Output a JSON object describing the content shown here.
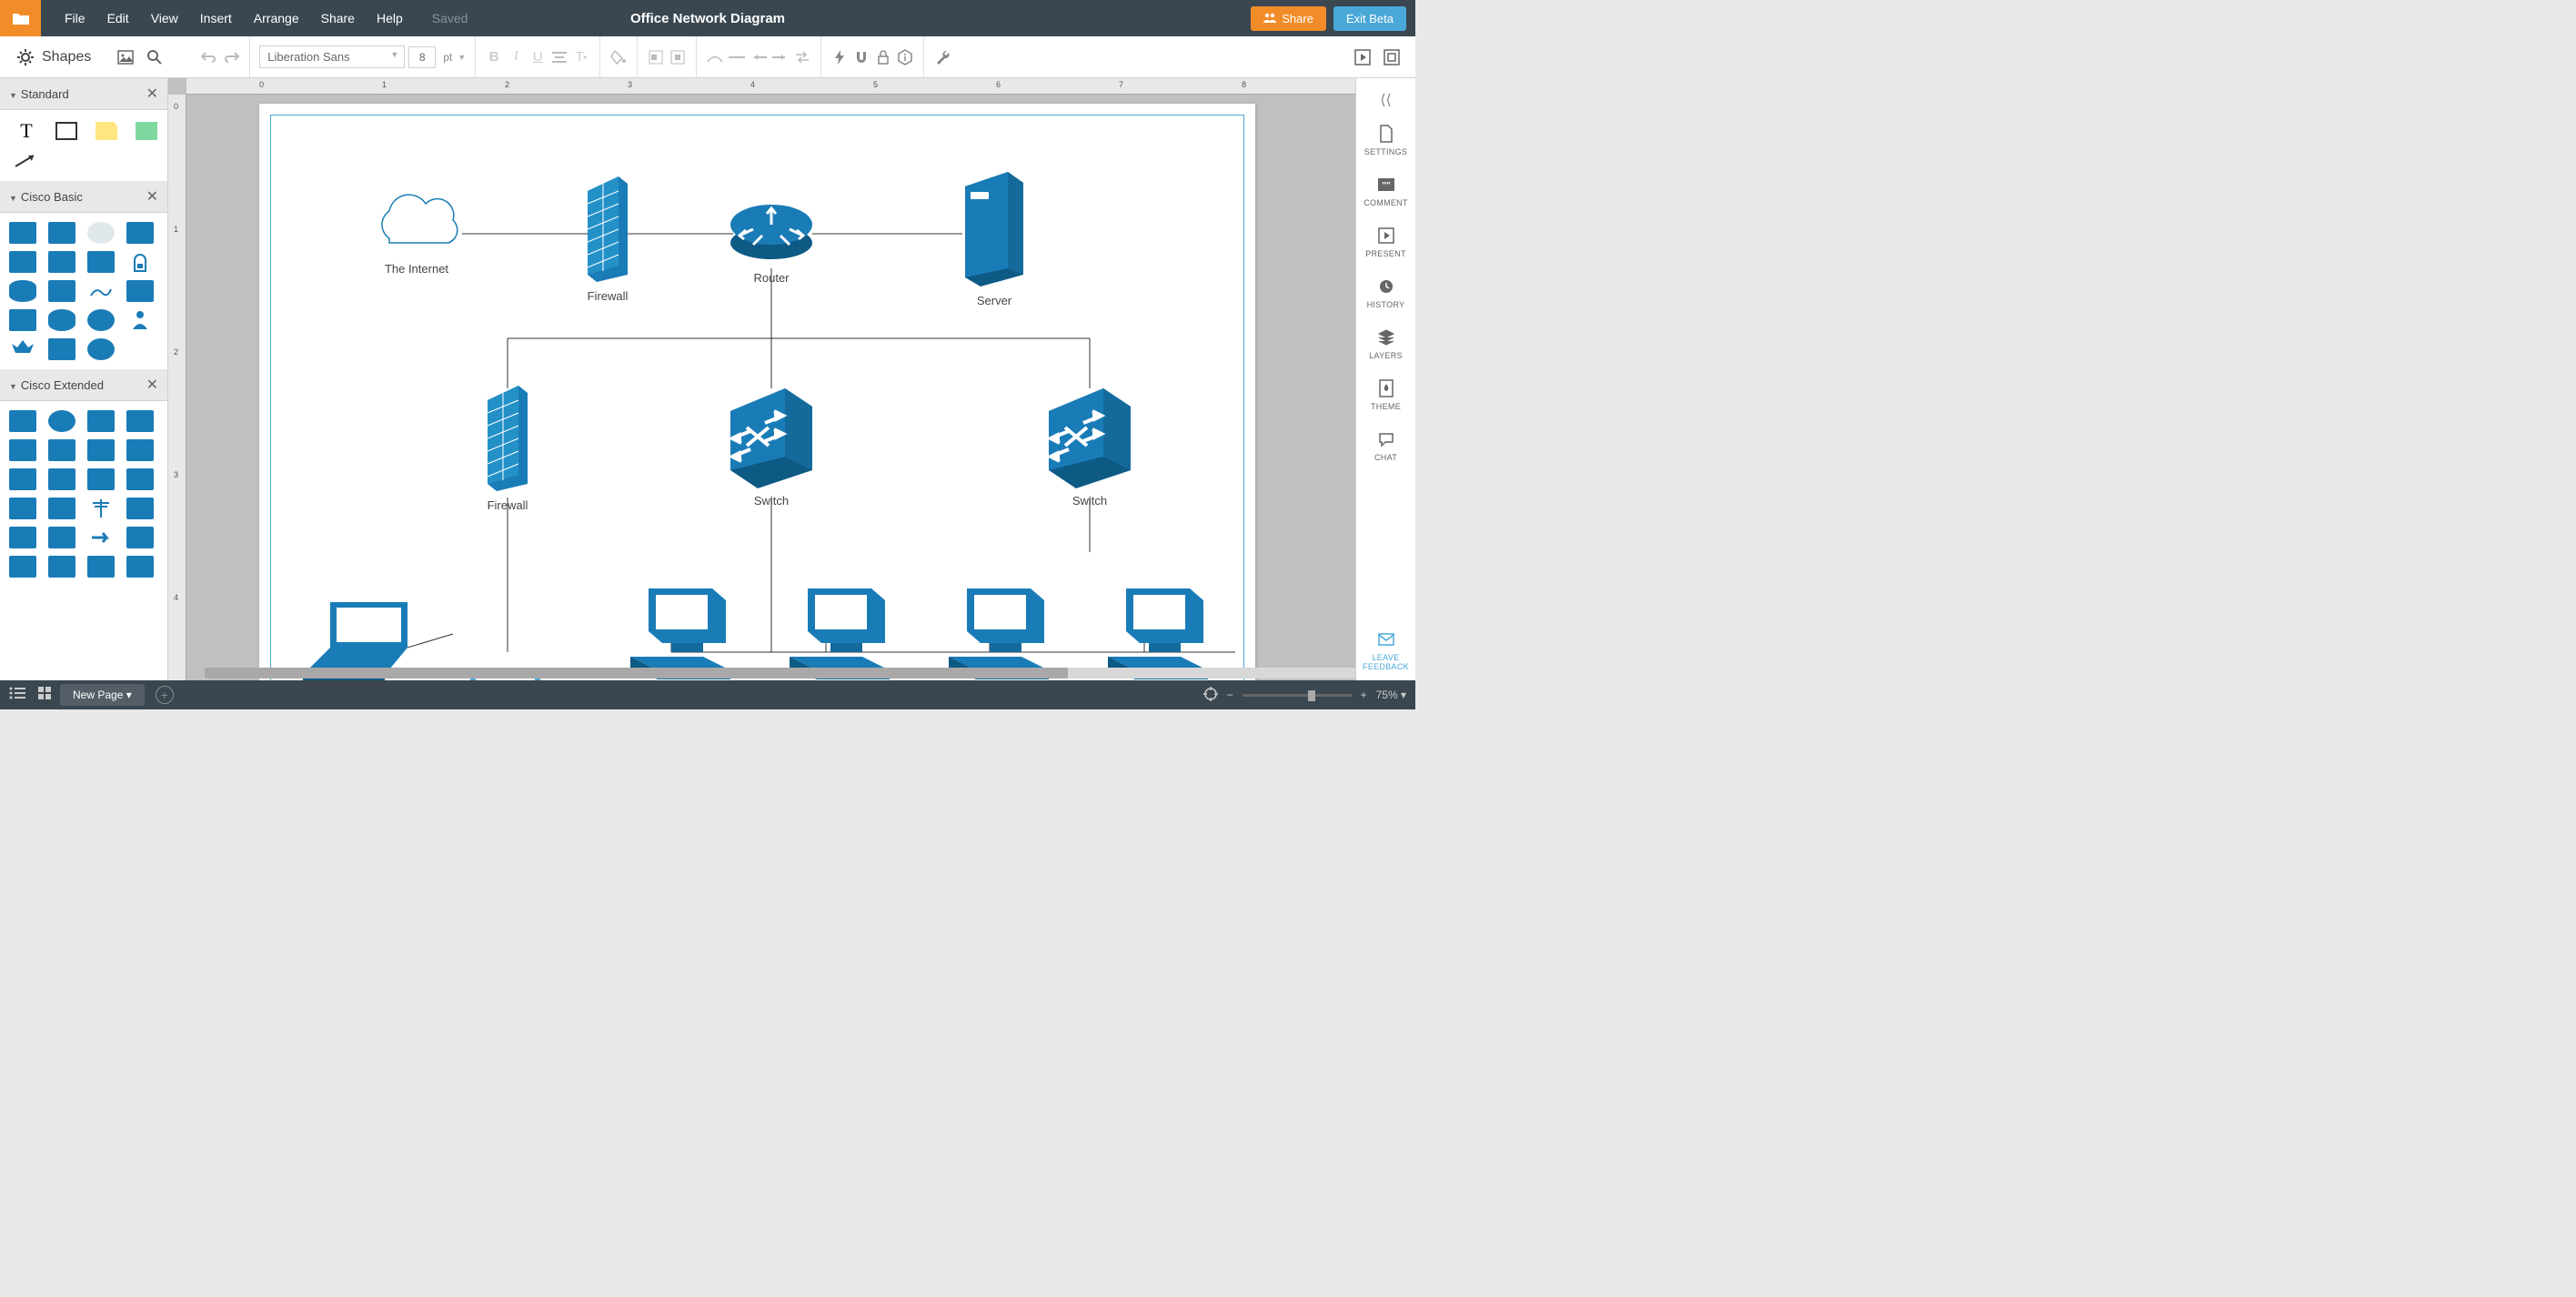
{
  "menu": {
    "file": "File",
    "edit": "Edit",
    "view": "View",
    "insert": "Insert",
    "arrange": "Arrange",
    "share": "Share",
    "help": "Help"
  },
  "save_status": "Saved",
  "doc_title": "Office Network Diagram",
  "buttons": {
    "share": "Share",
    "exit_beta": "Exit Beta"
  },
  "toolbar": {
    "shapes": "Shapes",
    "font": "Liberation Sans",
    "font_size": "8",
    "pt": "pt"
  },
  "panels": {
    "standard": "Standard",
    "cisco_basic": "Cisco Basic",
    "cisco_extended": "Cisco Extended"
  },
  "diagram": {
    "internet": "The Internet",
    "firewall1": "Firewall",
    "router": "Router",
    "server": "Server",
    "firewall2": "Firewall",
    "switch1": "Switch",
    "switch2": "Switch"
  },
  "rail": {
    "settings": "SETTINGS",
    "comment": "COMMENT",
    "present": "PRESENT",
    "history": "HISTORY",
    "layers": "LAYERS",
    "theme": "THEME",
    "chat": "CHAT",
    "leave": "LEAVE",
    "feedback": "FEEDBACK"
  },
  "bottom": {
    "new_page": "New Page ▾",
    "zoom": "75% ▾"
  },
  "ruler_h": [
    "0",
    "1",
    "2",
    "3",
    "4",
    "5",
    "6",
    "7",
    "8"
  ],
  "ruler_v": [
    "0",
    "1",
    "2",
    "3",
    "4"
  ]
}
